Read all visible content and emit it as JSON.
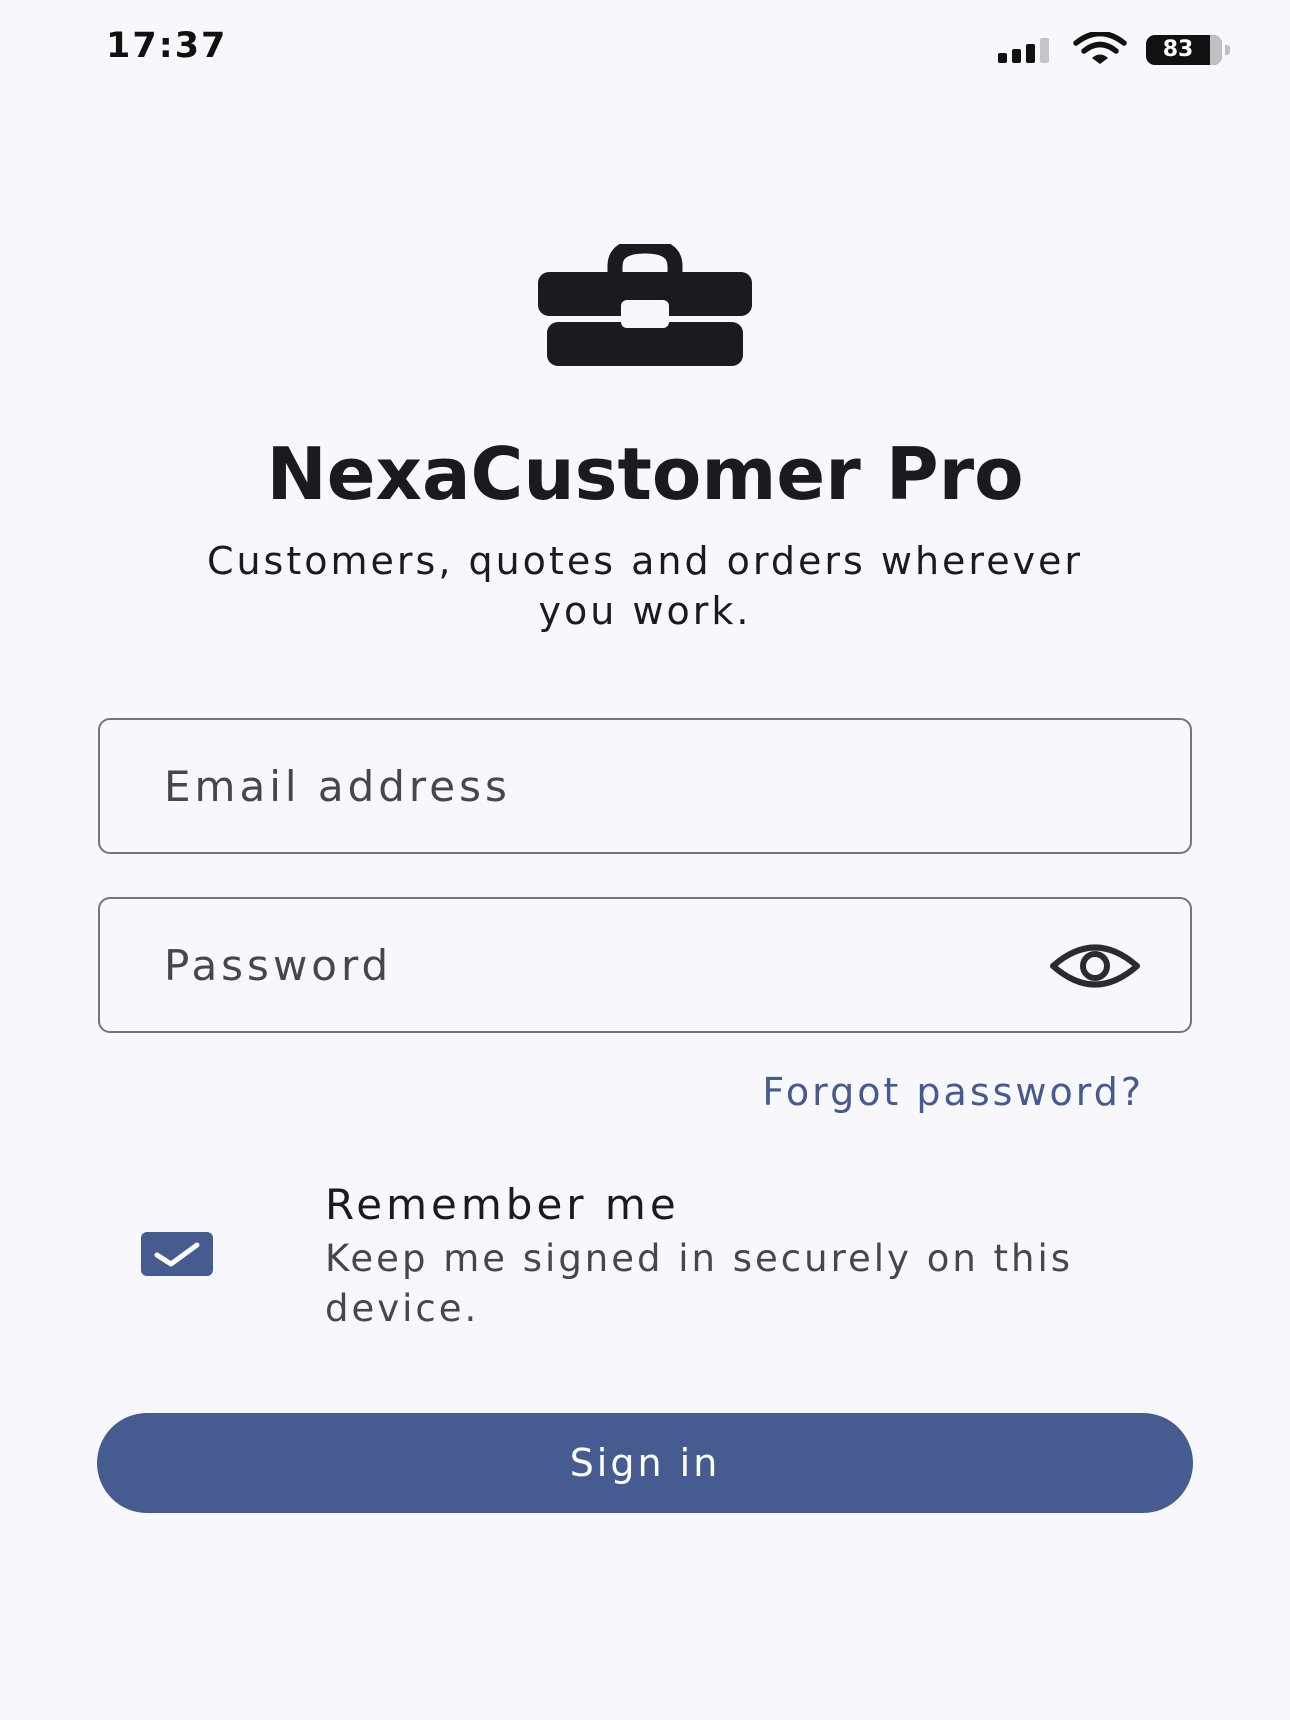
{
  "status_bar": {
    "time": "17:37",
    "battery_level": "83",
    "icons": [
      "signal-icon",
      "wifi-icon",
      "battery-icon"
    ]
  },
  "logo": {
    "icon": "briefcase-icon"
  },
  "app": {
    "title": "NexaCustomer Pro",
    "subtitle": "Customers, quotes and orders wherever you work."
  },
  "form": {
    "email": {
      "placeholder": "Email address",
      "value": ""
    },
    "password": {
      "placeholder": "Password",
      "value": "",
      "toggle_icon": "eye-icon"
    },
    "forgot_password_label": "Forgot password?",
    "remember_me": {
      "title": "Remember me",
      "description": "Keep me signed in securely on this device.",
      "checked": true
    },
    "sign_in_label": "Sign in"
  },
  "colors": {
    "background": "#f8f8fc",
    "primary": "#465b8f",
    "link": "#455b8f",
    "text": "#1b1b1f",
    "secondary_text": "#45464f",
    "outline": "#74757c"
  }
}
